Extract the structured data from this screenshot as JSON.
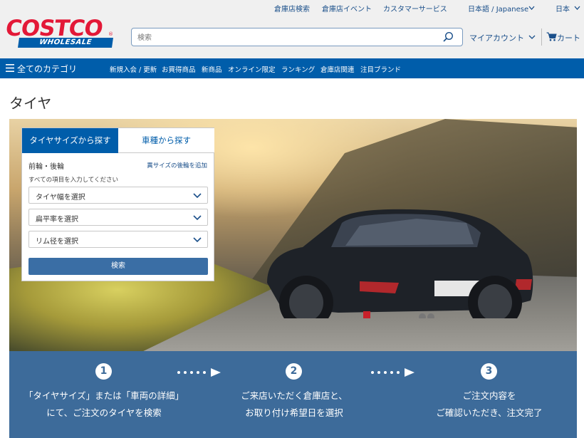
{
  "header": {
    "util_links": [
      "倉庫店検索",
      "倉庫店イベント",
      "カスタマーサービス",
      "日本語 / Japanese",
      "日本"
    ],
    "logo_text": "COSTCO",
    "logo_sub": "WHOLESALE",
    "search_placeholder": "検索",
    "account_label": "マイアカウント",
    "cart_label": "カート"
  },
  "nav": {
    "menu_label": "全てのカテゴリ",
    "items": [
      "新規入会 / 更新",
      "お買得商品",
      "新商品",
      "オンライン限定",
      "ランキング",
      "倉庫店関連",
      "注目ブランド"
    ]
  },
  "page_title": "タイヤ",
  "finder": {
    "tab_size": "タイヤサイズから探す",
    "tab_car": "車種から探す",
    "front_rear": "前輪・後輪",
    "add_rear_link": "異サイズの後輪を追加",
    "hint": "すべての項目を入力してください",
    "selects": [
      "タイヤ幅を選択",
      "扁平率を選択",
      "リム径を選択"
    ],
    "search_button": "検索"
  },
  "steps": [
    {
      "num": "1",
      "line1": "「タイヤサイズ」または「車両の詳細」",
      "line2": "にて、ご注文のタイヤを検索"
    },
    {
      "num": "2",
      "line1": "ご来店いただく倉庫店と、",
      "line2": "お取り付け希望日を選択"
    },
    {
      "num": "3",
      "line1": "ご注文内容を",
      "line2": "ご確認いただき、注文完了"
    }
  ],
  "colors": {
    "brand_blue": "#005daa",
    "brand_red": "#e31837",
    "steps_bg": "#3d6b9a"
  }
}
